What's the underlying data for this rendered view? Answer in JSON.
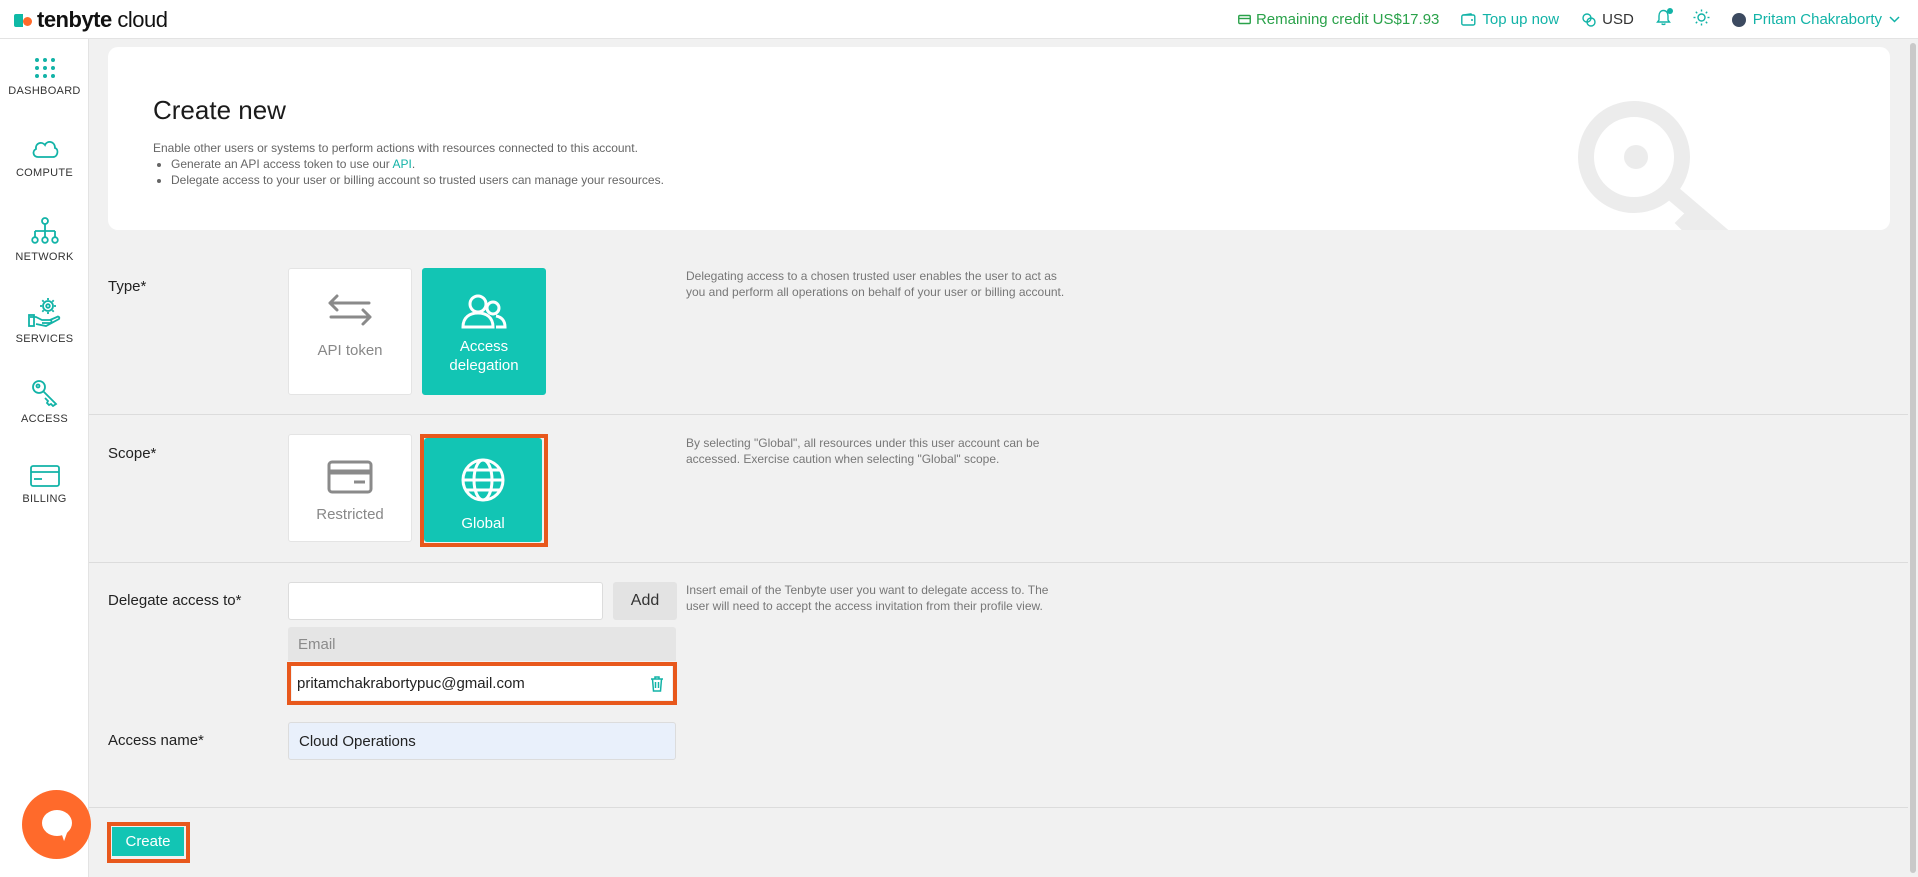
{
  "brand": {
    "name_bold": "tenbyte",
    "name_rest": " cloud"
  },
  "topbar": {
    "credit": "Remaining credit US$17.93",
    "topup": "Top up now",
    "currency": "USD",
    "user": "Pritam Chakraborty"
  },
  "sidebar": {
    "items": [
      {
        "label": "DASHBOARD",
        "icon": "grid-icon"
      },
      {
        "label": "COMPUTE",
        "icon": "cloud-icon"
      },
      {
        "label": "NETWORK",
        "icon": "network-icon"
      },
      {
        "label": "SERVICES",
        "icon": "services-icon"
      },
      {
        "label": "ACCESS",
        "icon": "key-icon"
      },
      {
        "label": "BILLING",
        "icon": "card-icon"
      }
    ]
  },
  "hero": {
    "title": "Create new",
    "description": "Enable other users or systems to perform actions with resources connected to this account.",
    "bullet1_pre": "Generate an API access token to use our ",
    "bullet1_link": "API",
    "bullet1_post": ".",
    "bullet2": "Delegate access to your user or billing account so trusted users can manage your resources."
  },
  "type": {
    "label": "Type*",
    "options": [
      {
        "label": "API token",
        "selected": false
      },
      {
        "label_line1": "Access",
        "label_line2": "delegation",
        "selected": true
      }
    ],
    "help": "Delegating access to a chosen trusted user enables the user to act as you and perform all operations on behalf of your user or billing account."
  },
  "scope": {
    "label": "Scope*",
    "options": [
      {
        "label": "Restricted",
        "selected": false
      },
      {
        "label": "Global",
        "selected": true
      }
    ],
    "help": "By selecting \"Global\", all resources under this user account can be accessed. Exercise caution when selecting \"Global\" scope."
  },
  "delegate": {
    "label": "Delegate access to*",
    "input_value": "",
    "add_label": "Add",
    "table_header": "Email",
    "emails": [
      "pritamchakrabortypuc@gmail.com"
    ],
    "help": "Insert email of the Tenbyte user you want to delegate access to. The user will need to accept the access invitation from their profile view."
  },
  "access_name": {
    "label": "Access name*",
    "value": "Cloud Operations"
  },
  "actions": {
    "create_label": "Create"
  },
  "colors": {
    "accent": "#12c5b4",
    "highlight": "#e8581c",
    "credit": "#2aa24a",
    "chat": "#ff6a2b"
  }
}
